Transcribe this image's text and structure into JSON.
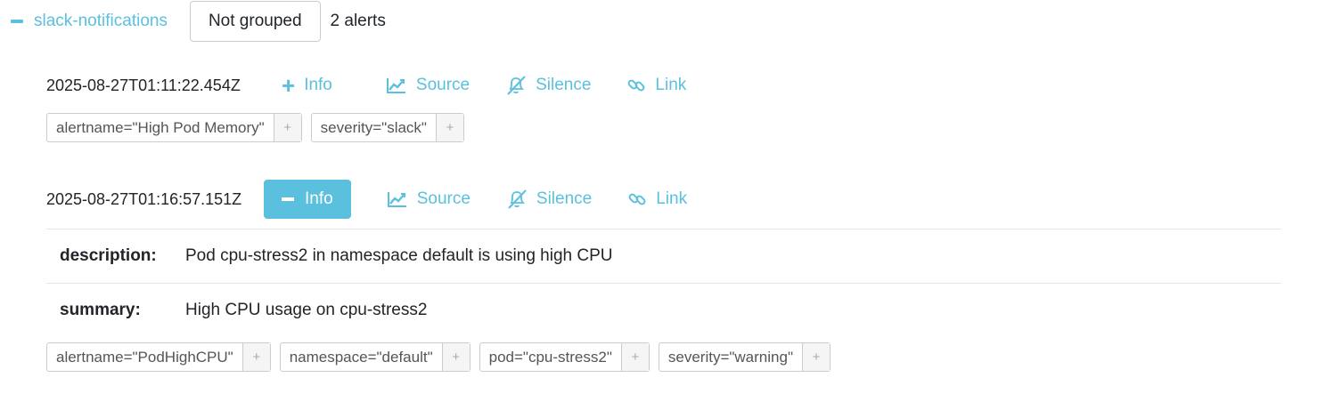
{
  "group": {
    "receiver": "slack-notifications",
    "grouping_button": "Not grouped",
    "alert_count": "2 alerts"
  },
  "actions": {
    "info": "Info",
    "source": "Source",
    "silence": "Silence",
    "link": "Link"
  },
  "alerts": [
    {
      "timestamp": "2025-08-27T01:11:22.454Z",
      "info_expanded": false,
      "labels": [
        "alertname=\"High Pod Memory\"",
        "severity=\"slack\""
      ]
    },
    {
      "timestamp": "2025-08-27T01:16:57.151Z",
      "info_expanded": true,
      "annotations": [
        {
          "key": "description:",
          "value": "Pod cpu-stress2 in namespace default is using high CPU"
        },
        {
          "key": "summary:",
          "value": "High CPU usage on cpu-stress2"
        }
      ],
      "labels": [
        "alertname=\"PodHighCPU\"",
        "namespace=\"default\"",
        "pod=\"cpu-stress2\"",
        "severity=\"warning\""
      ]
    }
  ],
  "add_label_glyph": "+",
  "colors": {
    "accent": "#5bc0de",
    "border": "#cccccc",
    "text": "#212529"
  }
}
